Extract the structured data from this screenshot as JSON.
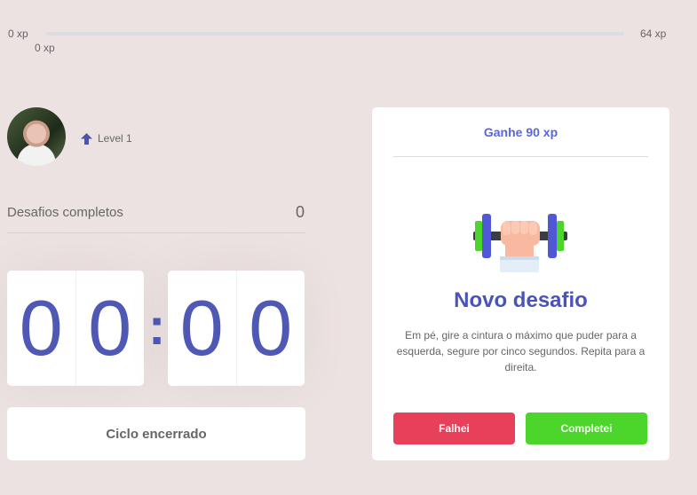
{
  "xp": {
    "min_label": "0 xp",
    "max_label": "64 xp",
    "current_label": "0 xp",
    "progress": 0
  },
  "profile": {
    "level_label": "Level 1"
  },
  "completed": {
    "label": "Desafios completos",
    "count": "0"
  },
  "countdown": {
    "minute_left": "0",
    "minute_right": "0",
    "separator": ":",
    "second_left": "0",
    "second_right": "0"
  },
  "cycle_button": {
    "label": "Ciclo encerrado"
  },
  "challenge": {
    "reward": "Ganhe 90 xp",
    "icon": "dumbbell-icon",
    "title": "Novo desafio",
    "description": "Em pé, gire a cintura o máximo que puder para a esquerda, segure por cinco segundos. Repita para a direita.",
    "fail_label": "Falhei",
    "complete_label": "Completei"
  },
  "colors": {
    "background": "#ede2e2",
    "primary": "#5965e0",
    "title": "#4953b8",
    "red": "#e83f5b",
    "green": "#4cd62b"
  }
}
